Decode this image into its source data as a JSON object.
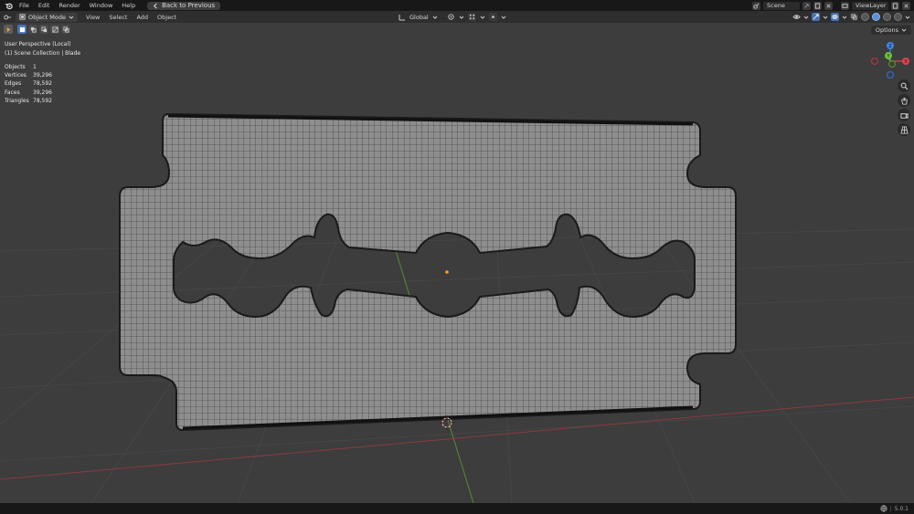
{
  "topbar": {
    "menus": [
      "File",
      "Edit",
      "Render",
      "Window",
      "Help"
    ],
    "back_button": "Back to Previous",
    "scene": "Scene",
    "view_layer": "ViewLayer"
  },
  "viewport_header": {
    "mode": "Object Mode",
    "menus": [
      "View",
      "Select",
      "Add",
      "Object"
    ],
    "transform_orientation": "Global"
  },
  "overlay": {
    "perspective": "User Perspective (Local)",
    "collection": "(1) Scene Collection | Blade"
  },
  "stats": [
    {
      "label": "Objects",
      "value": "1"
    },
    {
      "label": "Vertices",
      "value": "39,296"
    },
    {
      "label": "Edges",
      "value": "78,592"
    },
    {
      "label": "Faces",
      "value": "39,296"
    },
    {
      "label": "Triangles",
      "value": "78,592"
    }
  ],
  "options_label": "Options",
  "gizmo": {
    "z": "Z",
    "y": "Y",
    "x": "X"
  },
  "status": {
    "version": "5.0.1"
  },
  "colors": {
    "accent": "#4772b3",
    "axis_x": "#e0434d",
    "axis_y": "#6fbf3c",
    "axis_z": "#3a86e6",
    "viewport_bg": "#3d3d3d"
  }
}
